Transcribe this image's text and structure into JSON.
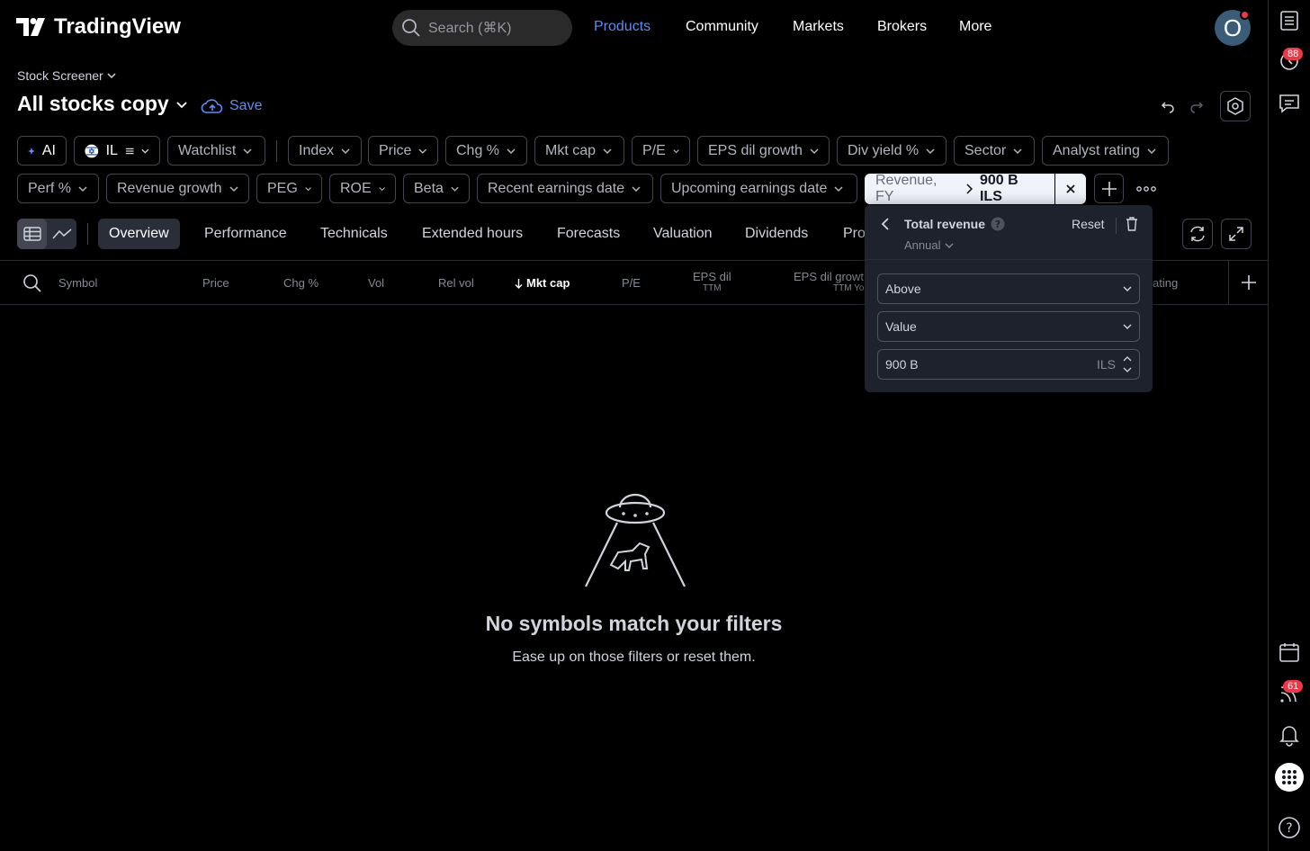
{
  "header": {
    "logo_text": "TradingView",
    "search_placeholder": "Search (⌘K)",
    "nav": [
      "Products",
      "Community",
      "Markets",
      "Brokers",
      "More"
    ],
    "nav_active": "Products",
    "avatar_letter": "O"
  },
  "rail": {
    "badge_ideas": "88",
    "badge_feed": "61"
  },
  "screener": {
    "breadcrumb": "Stock Screener",
    "title": "All stocks copy",
    "save_label": "Save"
  },
  "filters_row1": {
    "ai": "AI",
    "market": "IL",
    "items": [
      "Watchlist",
      "Index",
      "Price",
      "Chg %",
      "Mkt cap",
      "P/E",
      "EPS dil growth",
      "Div yield %",
      "Sector",
      "Analyst rating"
    ]
  },
  "filters_row2": {
    "items": [
      "Perf %",
      "Revenue growth",
      "PEG",
      "ROE",
      "Beta",
      "Recent earnings date",
      "Upcoming earnings date"
    ],
    "active_filter_name": "Revenue, FY",
    "active_filter_value": "900 B ILS"
  },
  "tabs": [
    "Overview",
    "Performance",
    "Technicals",
    "Extended hours",
    "Forecasts",
    "Valuation",
    "Dividends",
    "Pro"
  ],
  "tab_active": "Overview",
  "columns": {
    "symbol": "Symbol",
    "price": "Price",
    "chg": "Chg %",
    "vol": "Vol",
    "relvol": "Rel vol",
    "mktcap": "Mkt cap",
    "pe": "P/E",
    "epsdil": "EPS dil",
    "epsdil_sub": "TTM",
    "epsgrowth": "EPS dil growt",
    "epsgrowth_sub": "TTM Yo",
    "rating": "ating"
  },
  "empty": {
    "title": "No symbols match your filters",
    "subtitle": "Ease up on those filters or reset them."
  },
  "popup": {
    "title": "Total revenue",
    "period": "Annual",
    "reset": "Reset",
    "condition": "Above",
    "mode": "Value",
    "amount": "900 B",
    "currency": "ILS"
  },
  "colors": {
    "accent": "#5b8def",
    "badge": "#f23645",
    "panel": "#1e222d",
    "border": "#434651"
  }
}
